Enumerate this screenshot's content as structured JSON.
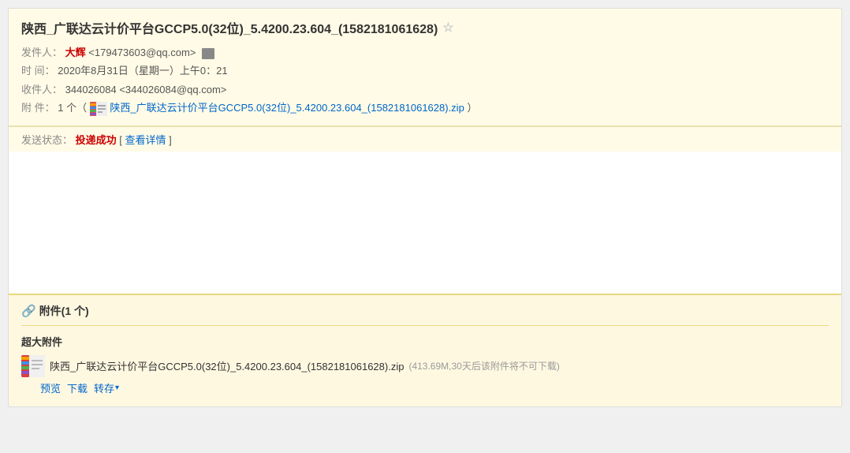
{
  "email": {
    "title": "陕西_广联达云计价平台GCCP5.0(32位)_5.4200.23.604_(1582181061628)",
    "star_icon": "☆",
    "sender_label": "发件人：",
    "sender_name": "大辉",
    "sender_email": "<179473603@qq.com>",
    "time_label": "时  间：",
    "time_value": "2020年8月31日（星期一）上午0：21",
    "recipient_label": "收件人：",
    "recipient_value": "344026084 <344026084@qq.com>",
    "attachment_label": "附  件：",
    "attachment_count": "1 个（",
    "attachment_filename": "陕西_广联达云计价平台GCCP5.0(32位)_5.4200.23.604_(1582181061628).zip",
    "attachment_close": "）",
    "status_label": "发送状态：",
    "status_value": "投递成功",
    "status_detail": "查看详情",
    "section_title": "附件(1 个)",
    "super_attach_label": "超大附件",
    "file_name": "陕西_广联达云计价平台GCCP5.0(32位)_5.4200.23.604_(1582181061628).zip",
    "file_meta": "(413.69M,30天后该附件将不可下载)",
    "action_preview": "预览",
    "action_download": "下载",
    "action_save": "转存",
    "chevron": "▾"
  }
}
